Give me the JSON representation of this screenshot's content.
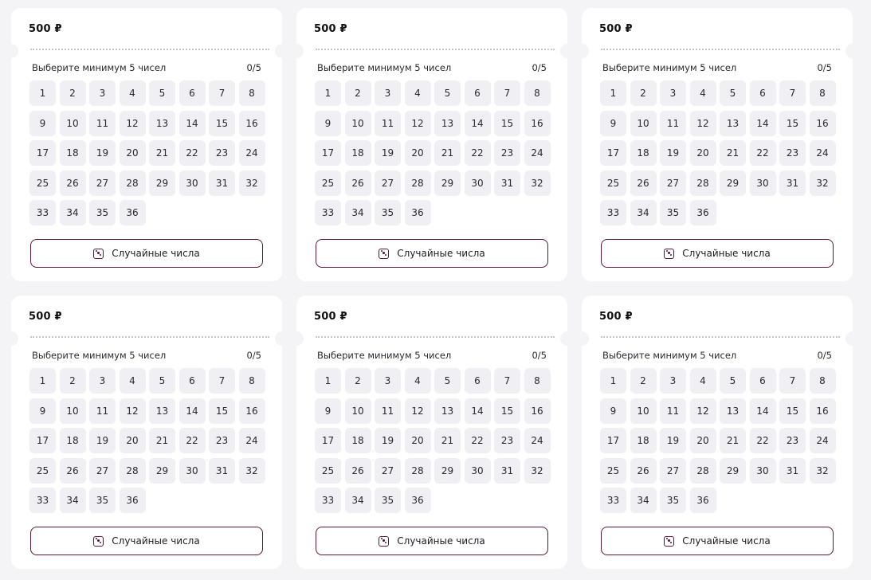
{
  "tickets": [
    {
      "price": "500 ₽",
      "prompt": "Выберите минимум 5 чисел",
      "counter": "0/5",
      "random_label": "Случайные числа"
    },
    {
      "price": "500 ₽",
      "prompt": "Выберите минимум 5 чисел",
      "counter": "0/5",
      "random_label": "Случайные числа"
    },
    {
      "price": "500 ₽",
      "prompt": "Выберите минимум 5 чисел",
      "counter": "0/5",
      "random_label": "Случайные числа"
    },
    {
      "price": "500 ₽",
      "prompt": "Выберите минимум 5 чисел",
      "counter": "0/5",
      "random_label": "Случайные числа"
    },
    {
      "price": "500 ₽",
      "prompt": "Выберите минимум 5 чисел",
      "counter": "0/5",
      "random_label": "Случайные числа"
    },
    {
      "price": "500 ₽",
      "prompt": "Выберите минимум 5 чисел",
      "counter": "0/5",
      "random_label": "Случайные числа"
    }
  ],
  "numbers": [
    "1",
    "2",
    "3",
    "4",
    "5",
    "6",
    "7",
    "8",
    "9",
    "10",
    "11",
    "12",
    "13",
    "14",
    "15",
    "16",
    "17",
    "18",
    "19",
    "20",
    "21",
    "22",
    "23",
    "24",
    "25",
    "26",
    "27",
    "28",
    "29",
    "30",
    "31",
    "32",
    "33",
    "34",
    "35",
    "36"
  ],
  "colors": {
    "accent": "#5a1637",
    "background": "#f4f3f6",
    "card": "#ffffff",
    "number_cell": "#f0eff3"
  }
}
